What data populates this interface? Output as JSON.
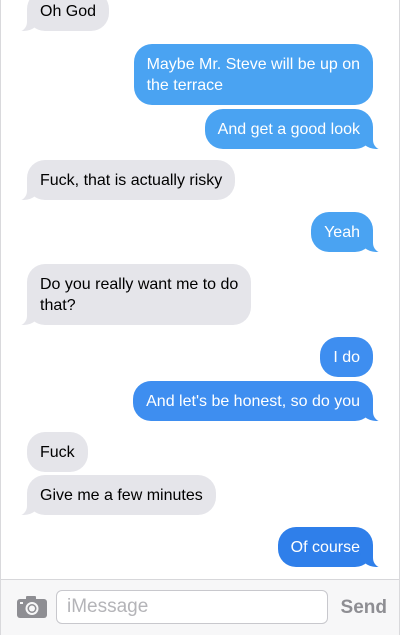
{
  "messages": [
    {
      "text": "Oh God",
      "from": "them"
    },
    {
      "text": "Maybe Mr. Steve will be up on",
      "text2": "the terrace",
      "from": "me"
    },
    {
      "text": "And get a good look",
      "from": "me"
    },
    {
      "text": "Fuck, that is actually risky",
      "from": "them"
    },
    {
      "text": "Yeah",
      "from": "me"
    },
    {
      "text": "Do you really want me to do",
      "text2": "that?",
      "from": "them"
    },
    {
      "text": "I do",
      "from": "me"
    },
    {
      "text": "And let's be honest, so do you",
      "from": "me"
    },
    {
      "text": "Fuck",
      "from": "them"
    },
    {
      "text": "Give me a few minutes",
      "from": "them"
    },
    {
      "text": "Of course",
      "from": "me"
    }
  ],
  "composer": {
    "placeholder": "iMessage",
    "send_label": "Send",
    "camera_icon": "camera-icon"
  },
  "colors": {
    "incoming_bubble": "#e5e5ea",
    "outgoing_bubble": "#3e8ef0",
    "send_disabled": "#8e8e93"
  }
}
